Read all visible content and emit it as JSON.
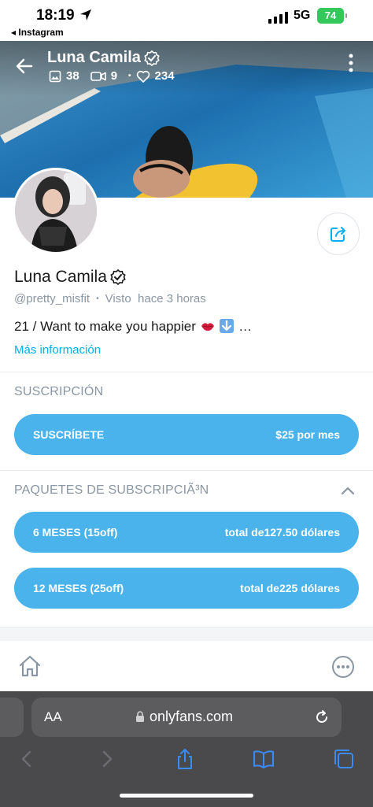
{
  "status_bar": {
    "time": "18:19",
    "back_app": "◂ Instagram",
    "network": "5G",
    "battery": "74"
  },
  "cover": {
    "name": "Luna Camila",
    "stats": {
      "photos": "38",
      "videos": "9",
      "likes": "234"
    }
  },
  "profile": {
    "name": "Luna Camila",
    "handle": "@pretty_misfit",
    "separator": "•",
    "seen": "Visto  hace 3 horas",
    "bio": "21 / Want to make you happier",
    "bio_ellipsis": "…",
    "more_info": "Más información"
  },
  "subscription": {
    "title": "SUSCRIPCIÓN",
    "button_label": "SUSCRÍBETE",
    "button_price": "$25 por mes"
  },
  "bundles": {
    "title": "PAQUETES DE SUBSCRIPCIÃ³N",
    "items": [
      {
        "label": "6 MESES (15off)",
        "price": "total de127.50 dólares"
      },
      {
        "label": "12 MESES (25off)",
        "price": "total de225 dólares"
      }
    ]
  },
  "browser": {
    "aa_label": "AA",
    "url": "onlyfans.com"
  },
  "colors": {
    "accent": "#00aff0",
    "pill": "#4ab3ec",
    "muted": "#8a96a3",
    "battery": "#34c759"
  }
}
